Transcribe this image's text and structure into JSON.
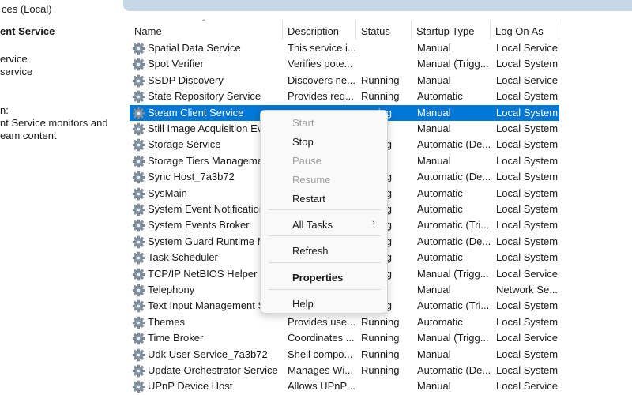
{
  "window": {
    "title": "ces (Local)"
  },
  "left_pane": {
    "service_name": "ent Service",
    "links": [
      "ervice",
      " service"
    ],
    "description_label": "n:",
    "description_lines": [
      "nt Service monitors and",
      "eam content"
    ]
  },
  "columns": [
    "Name",
    "Description",
    "Status",
    "Startup Type",
    "Log On As"
  ],
  "services": [
    {
      "name": "Spatial Data Service",
      "description": "This service i...",
      "status": "",
      "startup": "Manual",
      "logon": "Local Service"
    },
    {
      "name": "Spot Verifier",
      "description": "Verifies pote...",
      "status": "",
      "startup": "Manual (Trigg...",
      "logon": "Local System"
    },
    {
      "name": "SSDP Discovery",
      "description": "Discovers ne...",
      "status": "Running",
      "startup": "Manual",
      "logon": "Local Service"
    },
    {
      "name": "State Repository Service",
      "description": "Provides req...",
      "status": "Running",
      "startup": "Automatic",
      "logon": "Local System"
    },
    {
      "name": "Steam Client Service",
      "description": "",
      "status": "unning",
      "startup": "Manual",
      "logon": "Local System"
    },
    {
      "name": "Still Image Acquisition Ev",
      "description": "",
      "status": "",
      "startup": "Manual",
      "logon": "Local System"
    },
    {
      "name": "Storage Service",
      "description": "",
      "status": "unning",
      "startup": "Automatic (De...",
      "logon": "Local System"
    },
    {
      "name": "Storage Tiers Managemen",
      "description": "",
      "status": "",
      "startup": "Manual",
      "logon": "Local System"
    },
    {
      "name": "Sync Host_7a3b72",
      "description": "",
      "status": "unning",
      "startup": "Automatic (De...",
      "logon": "Local System"
    },
    {
      "name": "SysMain",
      "description": "",
      "status": "unning",
      "startup": "Automatic",
      "logon": "Local System"
    },
    {
      "name": "System Event Notification",
      "description": "",
      "status": "unning",
      "startup": "Automatic",
      "logon": "Local System"
    },
    {
      "name": "System Events Broker",
      "description": "",
      "status": "unning",
      "startup": "Automatic (Tri...",
      "logon": "Local System"
    },
    {
      "name": "System Guard Runtime M",
      "description": "",
      "status": "unning",
      "startup": "Automatic (De...",
      "logon": "Local System"
    },
    {
      "name": "Task Scheduler",
      "description": "",
      "status": "unning",
      "startup": "Automatic",
      "logon": "Local System"
    },
    {
      "name": "TCP/IP NetBIOS Helper",
      "description": "",
      "status": "unning",
      "startup": "Manual (Trigg...",
      "logon": "Local Service"
    },
    {
      "name": "Telephony",
      "description": "",
      "status": "",
      "startup": "Manual",
      "logon": "Network Se..."
    },
    {
      "name": "Text Input Management S",
      "description": "",
      "status": "unning",
      "startup": "Automatic (Tri...",
      "logon": "Local System"
    },
    {
      "name": "Themes",
      "description": "Provides use...",
      "status": "Running",
      "startup": "Automatic",
      "logon": "Local System"
    },
    {
      "name": "Time Broker",
      "description": "Coordinates ...",
      "status": "Running",
      "startup": "Manual (Trigg...",
      "logon": "Local Service"
    },
    {
      "name": "Udk User Service_7a3b72",
      "description": "Shell compo...",
      "status": "Running",
      "startup": "Manual",
      "logon": "Local System"
    },
    {
      "name": "Update Orchestrator Service",
      "description": "Manages Wi...",
      "status": "Running",
      "startup": "Automatic (De...",
      "logon": "Local System"
    },
    {
      "name": "UPnP Device Host",
      "description": "Allows UPnP ...",
      "status": "",
      "startup": "Manual",
      "logon": "Local Service"
    }
  ],
  "selected_index": 4,
  "context_menu": {
    "start": "Start",
    "stop": "Stop",
    "pause": "Pause",
    "resume": "Resume",
    "restart": "Restart",
    "all_tasks": "All Tasks",
    "submenu_arrow": "›",
    "refresh": "Refresh",
    "properties": "Properties",
    "help": "Help"
  },
  "colors": {
    "selection": "#0078d7",
    "title_band": "#c8d7e6"
  },
  "icons": {
    "service": "gear-icon",
    "sort": "sort-ascending-icon"
  }
}
